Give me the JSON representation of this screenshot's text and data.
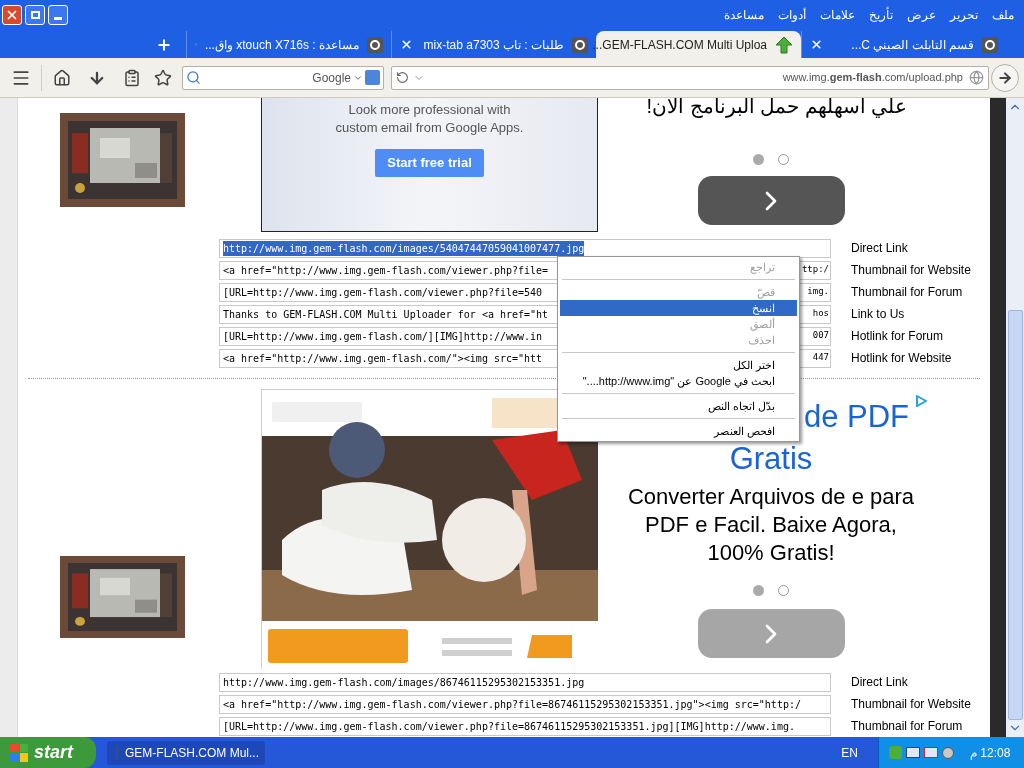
{
  "menu_bar": [
    "ملف",
    "تحرير",
    "عرض",
    "تأريخ",
    "علامات",
    "أدوات",
    "مساعدة"
  ],
  "tabs": [
    {
      "title": "قسم التابلت الصيني C...",
      "kind": "site",
      "selected": false
    },
    {
      "title": "GEM-FLASH.COM Multi Uploa...",
      "kind": "upload",
      "selected": true
    },
    {
      "title": "طلبات : تاب mix-tab a7303",
      "kind": "site",
      "selected": false
    },
    {
      "title": "مساعدة : xtouch X716s واق...",
      "kind": "site",
      "selected": false
    }
  ],
  "search": {
    "placeholder": "Google"
  },
  "address": {
    "url": "www.img.**gem-flash**.com/upload.php"
  },
  "uploads": [
    {
      "ad": {
        "kind": "text",
        "lines": [
          "Look more professional with",
          "custom email from Google Apps."
        ],
        "button": "Start free trial"
      },
      "side_ad": {
        "kind": "plain",
        "heading": [
          "علي اسهلهم حمل البرنامج الان!"
        ],
        "slides": [
          {
            "selected": true
          },
          {
            "selected": false
          }
        ]
      },
      "links": [
        {
          "value": "http://www.img.gem-flash.com/images/54047447059041007477.jpg",
          "label": "Direct Link",
          "selected": true
        },
        {
          "value": "<a href=\"http://www.img.gem-flash.com/viewer.php?file=",
          "tail": "ttp:/",
          "label": "Thumbnail for Website",
          "selected": false
        },
        {
          "value": "[URL=http://www.img.gem-flash.com/viewer.php?file=540",
          "tail": "img.",
          "label": "Thumbnail for Forum",
          "selected": false
        },
        {
          "value": "Thanks to GEM-FLASH.COM Multi Uploader for <a href=\"ht",
          "tail": "hos",
          "label": "Link to Us",
          "selected": false
        },
        {
          "value": "[URL=http://www.img.gem-flash.com/][IMG]http://www.in",
          "tail": "007",
          "label": "Hotlink for Forum",
          "selected": false
        },
        {
          "value": "<a href=\"http://www.img.gem-flash.com/\"><img src=\"htt",
          "tail": "447",
          "label": "Hotlink for Website",
          "selected": false
        }
      ]
    },
    {
      "ad": {
        "kind": "picture"
      },
      "side_ad": {
        "kind": "ad",
        "heading": [
          "de PDF",
          "Gratis"
        ],
        "body": "Converter Arquivos de e para PDF e Facil. Baixe Agora, 100% Gratis!",
        "slides": [
          {
            "selected": true
          },
          {
            "selected": false
          }
        ]
      },
      "links": [
        {
          "value": "http://www.img.gem-flash.com/images/86746115295302153351.jpg",
          "label": "Direct Link",
          "selected": false
        },
        {
          "value": "<a href=\"http://www.img.gem-flash.com/viewer.php?file=86746115295302153351.jpg\"><img src=\"http:/",
          "label": "Thumbnail for Website",
          "selected": false
        },
        {
          "value": "[URL=http://www.img.gem-flash.com/viewer.php?file=86746115295302153351.jpg][IMG]http://www.img.",
          "label": "Thumbnail for Forum",
          "selected": false
        }
      ]
    }
  ],
  "context_menu": [
    {
      "kind": "item",
      "label": "تراجع",
      "disabled": true,
      "selected": false
    },
    {
      "kind": "separator"
    },
    {
      "kind": "item",
      "label": "قصّ",
      "disabled": true,
      "selected": false
    },
    {
      "kind": "item",
      "label": "انسخ",
      "disabled": false,
      "selected": true
    },
    {
      "kind": "item",
      "label": "ألصق",
      "disabled": true,
      "selected": false
    },
    {
      "kind": "item",
      "label": "احذف",
      "disabled": true,
      "selected": false
    },
    {
      "kind": "separator"
    },
    {
      "kind": "item",
      "label": "اختر الكل",
      "disabled": false,
      "selected": false
    },
    {
      "kind": "item",
      "label": "ابحث في Google عن \"http://www.img....\"",
      "disabled": false,
      "selected": false
    },
    {
      "kind": "separator"
    },
    {
      "kind": "item",
      "label": "بدّل اتجاه النص",
      "disabled": false,
      "selected": false
    },
    {
      "kind": "separator"
    },
    {
      "kind": "item",
      "label": "افحص العنصر",
      "disabled": false,
      "selected": false
    }
  ],
  "taskbar": {
    "start": "start",
    "tasks": [
      {
        "title": "GEM-FLASH.COM Mul...",
        "selected": true
      }
    ],
    "language": "EN",
    "clock": "12:08 م"
  }
}
